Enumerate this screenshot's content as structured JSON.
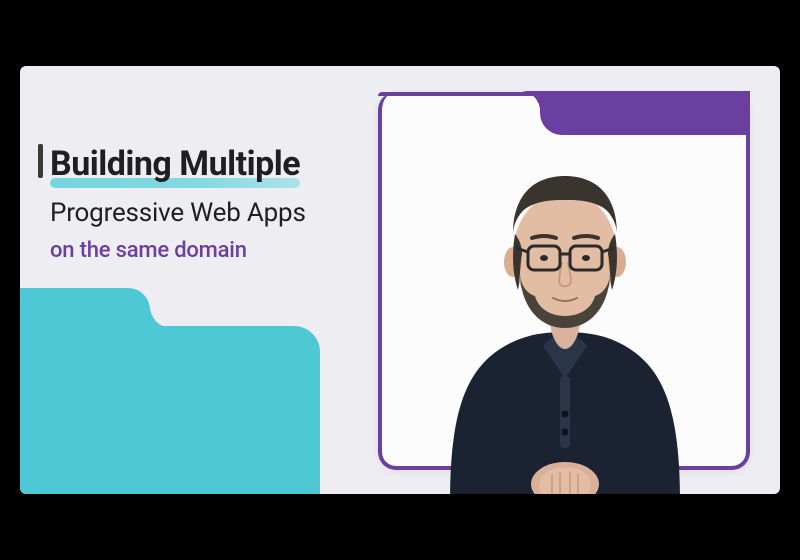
{
  "title": {
    "line1": "Building Multiple",
    "line2": "Progressive Web Apps",
    "line3": "on the same domain"
  },
  "colors": {
    "accent_purple": "#6b3fa0",
    "accent_teal": "#4ec8d4",
    "text_dark": "#1f1f1f",
    "bg": "#eeedf2"
  },
  "logo": {
    "name": "chrome-logo"
  }
}
